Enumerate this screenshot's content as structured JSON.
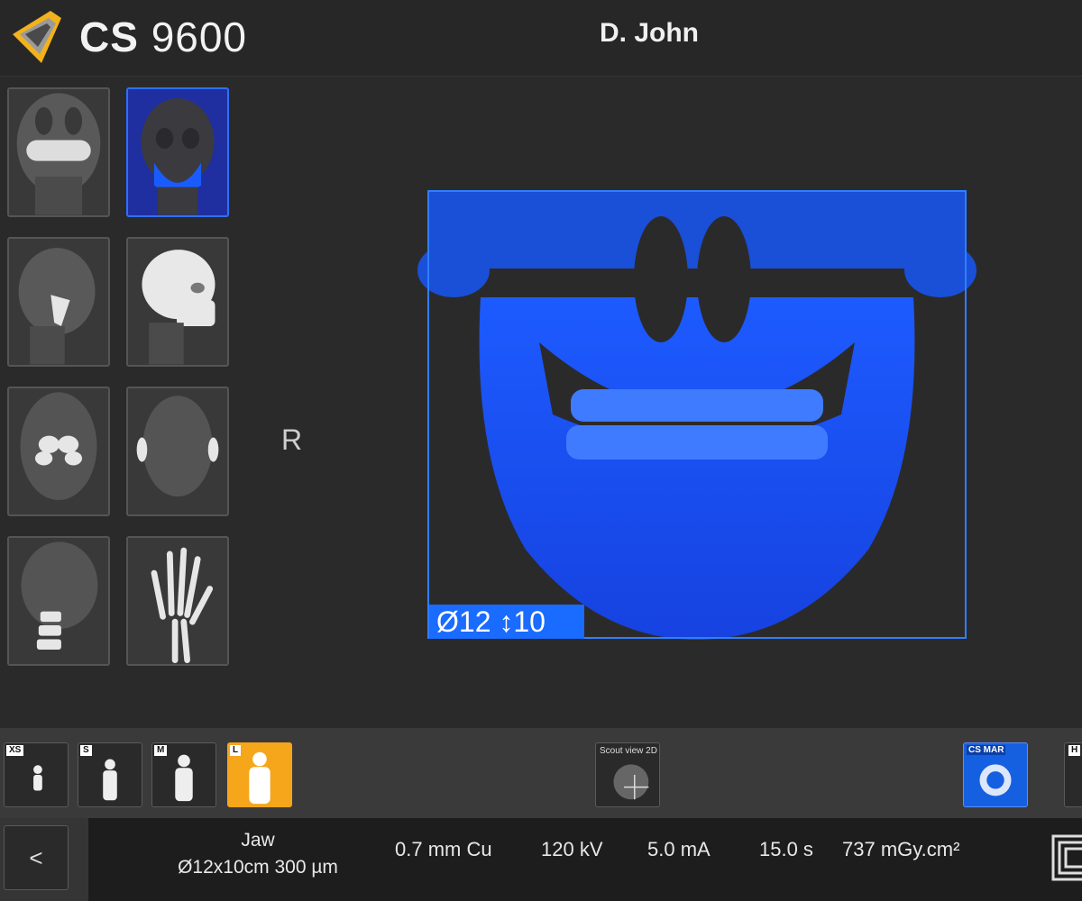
{
  "header": {
    "app_name_bold": "CS",
    "app_name_model": "9600",
    "patient_name": "D. John"
  },
  "exam_types": [
    {
      "name": "panoramic-exam"
    },
    {
      "name": "jaw-3d-exam",
      "selected": true
    },
    {
      "name": "tmj-lateral-exam"
    },
    {
      "name": "cephalometric-lateral-exam"
    },
    {
      "name": "sinus-exam"
    },
    {
      "name": "ear-exam"
    },
    {
      "name": "cervical-spine-exam"
    },
    {
      "name": "hand-wrist-exam"
    }
  ],
  "view": {
    "orientation_label": "R",
    "fov_label": "Ø12 ↕10"
  },
  "patient_size": {
    "options": [
      {
        "tag": "XS"
      },
      {
        "tag": "S"
      },
      {
        "tag": "M"
      },
      {
        "tag": "L",
        "active": true
      }
    ],
    "scout_view_label": "Scout view 2D",
    "mar_label": "CS MAR",
    "extra_tag": "H"
  },
  "acquisition": {
    "back_label": "<",
    "region_line1": "Jaw",
    "region_line2": "Ø12x10cm 300 µm",
    "filter": "0.7 mm Cu",
    "kv": "120 kV",
    "ma": "5.0 mA",
    "time": "15.0 s",
    "dose": "737 mGy.cm²"
  },
  "colors": {
    "background": "#2b2a2b",
    "accent_blue": "#1a6bff",
    "active_orange": "#f5a61a"
  }
}
